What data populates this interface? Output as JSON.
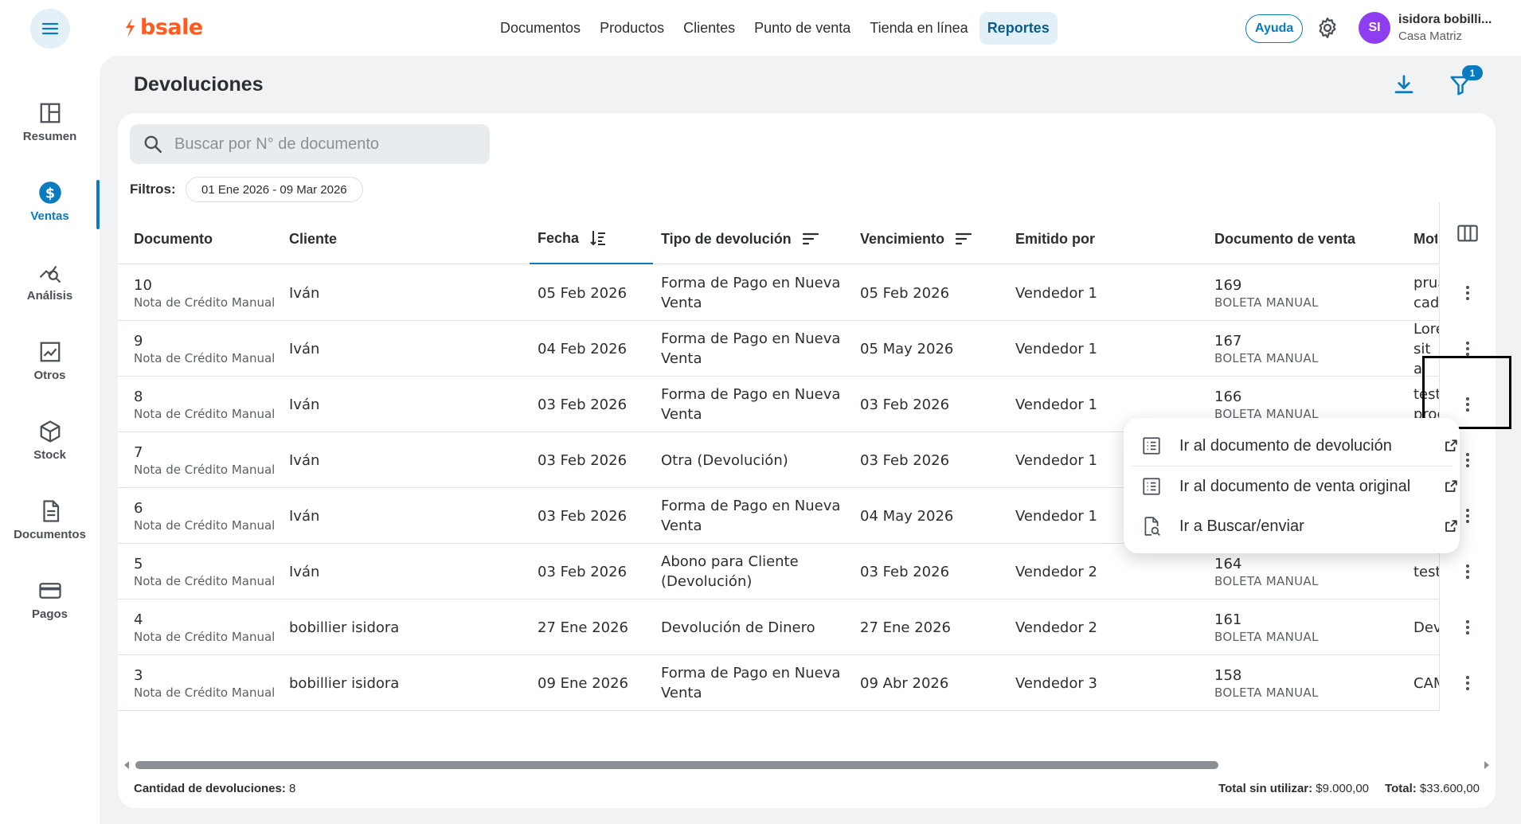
{
  "app": {
    "logo_text": "bsale",
    "brand_color": "#ff5a1f",
    "accent_color": "#0a7bbf"
  },
  "topnav": {
    "items": [
      "Documentos",
      "Productos",
      "Clientes",
      "Punto de venta",
      "Tienda en línea",
      "Reportes"
    ],
    "active": "Reportes",
    "help_label": "Ayuda",
    "user_initials": "SI",
    "user_name": "isidora bobilli...",
    "user_branch": "Casa Matriz"
  },
  "sidebar": {
    "items": [
      {
        "label": "Resumen",
        "icon": "layout-icon"
      },
      {
        "label": "Ventas",
        "icon": "dollar-icon"
      },
      {
        "label": "Análisis",
        "icon": "analytics-icon"
      },
      {
        "label": "Otros",
        "icon": "chart-icon"
      },
      {
        "label": "Stock",
        "icon": "box-icon"
      },
      {
        "label": "Documentos",
        "icon": "document-icon"
      },
      {
        "label": "Pagos",
        "icon": "card-icon"
      }
    ],
    "active": "Ventas"
  },
  "page": {
    "title": "Devoluciones",
    "filter_badge": "1",
    "search_placeholder": "Buscar por N° de documento",
    "filters_label": "Filtros:",
    "filter_chip": "01 Ene 2026 - 09 Mar 2026"
  },
  "table": {
    "columns": [
      "Documento",
      "Cliente",
      "Fecha",
      "Tipo de devolución",
      "Vencimiento",
      "Emitido por",
      "Documento de venta",
      "Mot"
    ],
    "rows": [
      {
        "doc": "10",
        "doc_type": "Nota de Crédito Manual",
        "client": "Iván",
        "date": "05 Feb 2026",
        "type_1": "Forma de Pago en Nueva",
        "type_2": "Venta",
        "due": "05 Feb 2026",
        "issuer": "Vendedor 1",
        "sale_doc": "169",
        "sale_type": "BOLETA MANUAL",
        "reason_1": "pruε",
        "reason_2": "cadε"
      },
      {
        "doc": "9",
        "doc_type": "Nota de Crédito Manual",
        "client": "Iván",
        "date": "04 Feb 2026",
        "type_1": "Forma de Pago en Nueva",
        "type_2": "Venta",
        "due": "05 May 2026",
        "issuer": "Vendedor 1",
        "sale_doc": "167",
        "sale_type": "BOLETA MANUAL",
        "reason_1": "Lore",
        "reason_2": "sit a"
      },
      {
        "doc": "8",
        "doc_type": "Nota de Crédito Manual",
        "client": "Iván",
        "date": "03 Feb 2026",
        "type_1": "Forma de Pago en Nueva",
        "type_2": "Venta",
        "due": "03 Feb 2026",
        "issuer": "Vendedor 1",
        "sale_doc": "166",
        "sale_type": "BOLETA MANUAL",
        "reason_1": "test",
        "reason_2": "proc"
      },
      {
        "doc": "7",
        "doc_type": "Nota de Crédito Manual",
        "client": "Iván",
        "date": "03 Feb 2026",
        "type_1": "Otra (Devolución)",
        "type_2": "",
        "due": "03 Feb 2026",
        "issuer": "Vendedor 1",
        "sale_doc": "",
        "sale_type": "",
        "reason_1": "",
        "reason_2": ""
      },
      {
        "doc": "6",
        "doc_type": "Nota de Crédito Manual",
        "client": "Iván",
        "date": "03 Feb 2026",
        "type_1": "Forma de Pago en Nueva",
        "type_2": "Venta",
        "due": "04 May 2026",
        "issuer": "Vendedor 1",
        "sale_doc": "",
        "sale_type": "",
        "reason_1": "",
        "reason_2": ""
      },
      {
        "doc": "5",
        "doc_type": "Nota de Crédito Manual",
        "client": "Iván",
        "date": "03 Feb 2026",
        "type_1": "Abono para Cliente",
        "type_2": "(Devolución)",
        "due": "03 Feb 2026",
        "issuer": "Vendedor 2",
        "sale_doc": "164",
        "sale_type": "BOLETA MANUAL",
        "reason_1": "test",
        "reason_2": ""
      },
      {
        "doc": "4",
        "doc_type": "Nota de Crédito Manual",
        "client": "bobillier isidora",
        "date": "27 Ene 2026",
        "type_1": "Devolución de Dinero",
        "type_2": "",
        "due": "27 Ene 2026",
        "issuer": "Vendedor 2",
        "sale_doc": "161",
        "sale_type": "BOLETA MANUAL",
        "reason_1": "Dev",
        "reason_2": ""
      },
      {
        "doc": "3",
        "doc_type": "Nota de Crédito Manual",
        "client": "bobillier isidora",
        "date": "09 Ene 2026",
        "type_1": "Forma de Pago en Nueva",
        "type_2": "Venta",
        "due": "09 Abr 2026",
        "issuer": "Vendedor 3",
        "sale_doc": "158",
        "sale_type": "BOLETA MANUAL",
        "reason_1": "CAM",
        "reason_2": ""
      }
    ]
  },
  "footer": {
    "count_label": "Cantidad de devoluciones:",
    "count_value": "8",
    "unused_label": "Total sin utilizar:",
    "unused_value": "$9.000,00",
    "total_label": "Total:",
    "total_value": "$33.600,00"
  },
  "menu": {
    "items": [
      {
        "label": "Ir al documento de devolución",
        "icon": "list-icon"
      },
      {
        "label": "Ir al documento de venta original",
        "icon": "list-icon"
      },
      {
        "label": "Ir a Buscar/enviar",
        "icon": "doc-search-icon"
      }
    ]
  }
}
